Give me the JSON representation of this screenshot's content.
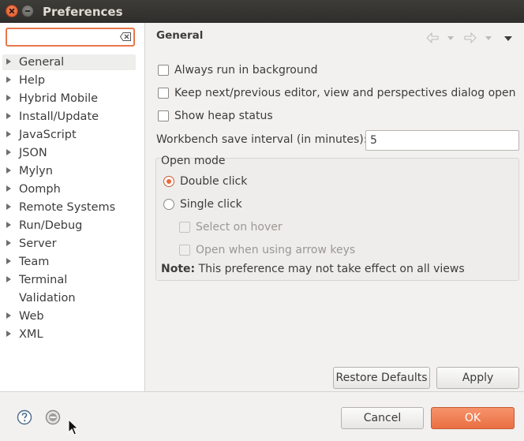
{
  "window": {
    "title": "Preferences"
  },
  "filter": {
    "value": "",
    "placeholder": ""
  },
  "tree": {
    "items": [
      {
        "label": "General",
        "expandable": true,
        "selected": true
      },
      {
        "label": "Help",
        "expandable": true
      },
      {
        "label": "Hybrid Mobile",
        "expandable": true
      },
      {
        "label": "Install/Update",
        "expandable": true
      },
      {
        "label": "JavaScript",
        "expandable": true
      },
      {
        "label": "JSON",
        "expandable": true
      },
      {
        "label": "Mylyn",
        "expandable": true
      },
      {
        "label": "Oomph",
        "expandable": true
      },
      {
        "label": "Remote Systems",
        "expandable": true
      },
      {
        "label": "Run/Debug",
        "expandable": true
      },
      {
        "label": "Server",
        "expandable": true
      },
      {
        "label": "Team",
        "expandable": true
      },
      {
        "label": "Terminal",
        "expandable": true
      },
      {
        "label": "Validation",
        "expandable": false
      },
      {
        "label": "Web",
        "expandable": true
      },
      {
        "label": "XML",
        "expandable": true
      }
    ]
  },
  "page": {
    "title": "General",
    "options": {
      "always_run_bg": {
        "label": "Always run in background",
        "checked": false
      },
      "keep_next_prev": {
        "label": "Keep next/previous editor, view and perspectives dialog open",
        "checked": false
      },
      "show_heap": {
        "label": "Show heap status",
        "checked": false
      }
    },
    "interval": {
      "label": "Workbench save interval (in minutes):",
      "value": "5"
    },
    "open_mode": {
      "title": "Open mode",
      "double_click": "Double click",
      "single_click": "Single click",
      "selected": "Double click",
      "select_on_hover": "Select on hover",
      "open_arrow_keys": "Open when using arrow keys"
    },
    "note": {
      "bold": "Note:",
      "text": "This preference may not take effect on all views"
    }
  },
  "buttons": {
    "restore_defaults": "Restore Defaults",
    "apply": "Apply",
    "cancel": "Cancel",
    "ok": "OK"
  },
  "icons": {
    "back": "back-arrow-icon",
    "forward": "forward-arrow-icon",
    "menu": "view-menu-icon",
    "help": "help-icon",
    "status": "status-icon"
  },
  "colors": {
    "accent": "#e9774a",
    "titlebar": "#3d3c38",
    "ok_button": "#ea6f43"
  }
}
